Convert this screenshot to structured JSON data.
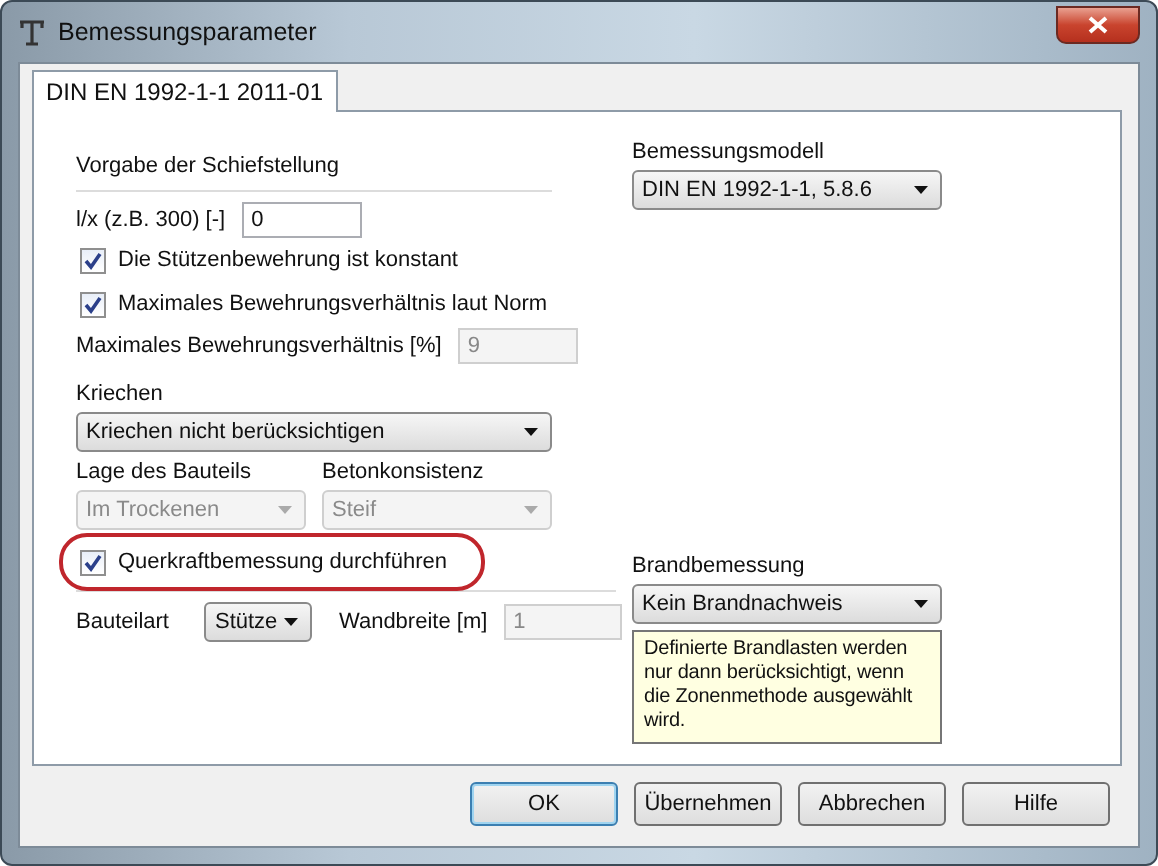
{
  "window": {
    "title": "Bemessungsparameter"
  },
  "tabs": [
    {
      "label": "DIN EN 1992-1-1 2011-01",
      "selected": true
    }
  ],
  "left": {
    "section_title": "Vorgabe der Schiefstellung",
    "slope": {
      "label": "l/x (z.B. 300) [-]",
      "value": "0"
    },
    "checkboxes": [
      {
        "label": "Die Stützenbewehrung ist konstant",
        "checked": true
      },
      {
        "label": "Maximales Bewehrungsverhältnis laut Norm",
        "checked": true
      }
    ],
    "max_ratio": {
      "label": "Maximales Bewehrungsverhältnis [%]",
      "value": "9",
      "disabled": true
    },
    "creep": {
      "label": "Kriechen",
      "value": "Kriechen nicht berücksichtigen",
      "disabled": false
    },
    "location": {
      "label": "Lage des Bauteils",
      "value": "Im Trockenen",
      "disabled": true
    },
    "consistency": {
      "label": "Betonkonsistenz",
      "value": "Steif",
      "disabled": true
    },
    "shear": {
      "label": "Querkraftbemessung durchführen",
      "checked": true,
      "highlighted": true
    },
    "member_type": {
      "label": "Bauteilart",
      "value": "Stütze",
      "disabled": false
    },
    "wall_width": {
      "label": "Wandbreite [m]",
      "value": "1",
      "disabled": true
    }
  },
  "right": {
    "model": {
      "label": "Bemessungsmodell",
      "value": "DIN EN 1992-1-1, 5.8.6",
      "disabled": false
    },
    "fire": {
      "label": "Brandbemessung",
      "value": "Kein Brandnachweis",
      "disabled": false
    },
    "note": "Definierte Brandlasten werden nur dann berücksichtigt, wenn die Zonenmethode ausgewählt wird."
  },
  "buttons": [
    {
      "label": "OK",
      "default": true
    },
    {
      "label": "Übernehmen",
      "default": false
    },
    {
      "label": "Abbrechen",
      "default": false
    },
    {
      "label": "Hilfe",
      "default": false
    }
  ]
}
